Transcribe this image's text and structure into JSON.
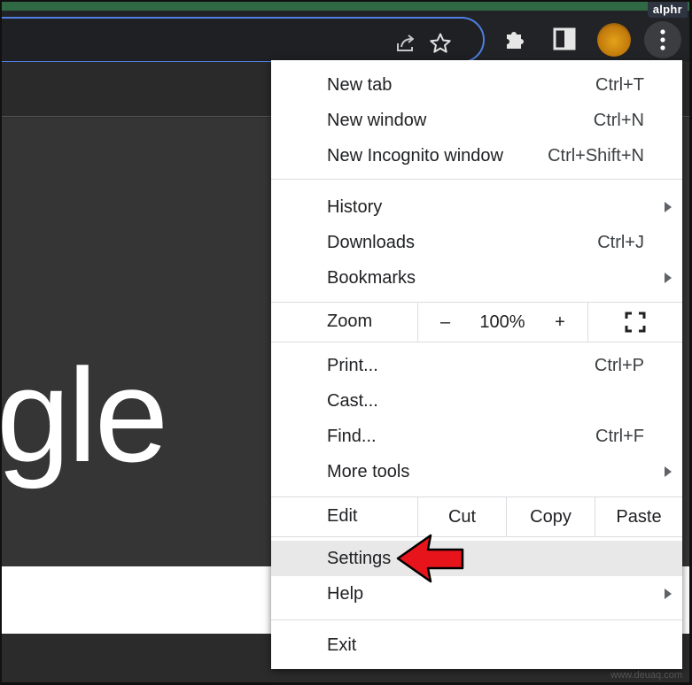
{
  "brand": "alphr",
  "watermark": "www.deuaq.com",
  "page_logo_partial": "gle",
  "menu": {
    "section1": [
      {
        "label": "New tab",
        "shortcut": "Ctrl+T"
      },
      {
        "label": "New window",
        "shortcut": "Ctrl+N"
      },
      {
        "label": "New Incognito window",
        "shortcut": "Ctrl+Shift+N"
      }
    ],
    "section2": [
      {
        "label": "History",
        "submenu": true
      },
      {
        "label": "Downloads",
        "shortcut": "Ctrl+J"
      },
      {
        "label": "Bookmarks",
        "submenu": true
      }
    ],
    "zoom": {
      "label": "Zoom",
      "minus": "–",
      "value": "100%",
      "plus": "+"
    },
    "section3": [
      {
        "label": "Print...",
        "shortcut": "Ctrl+P"
      },
      {
        "label": "Cast..."
      },
      {
        "label": "Find...",
        "shortcut": "Ctrl+F"
      },
      {
        "label": "More tools",
        "submenu": true
      }
    ],
    "edit": {
      "label": "Edit",
      "cut": "Cut",
      "copy": "Copy",
      "paste": "Paste"
    },
    "settings": {
      "label": "Settings"
    },
    "help": {
      "label": "Help",
      "submenu": true
    },
    "exit": {
      "label": "Exit"
    }
  },
  "colors": {
    "omnibox_focus": "#4f7fe3",
    "annotation_arrow": "#e8141c",
    "highlight": "#e8e8e8"
  }
}
